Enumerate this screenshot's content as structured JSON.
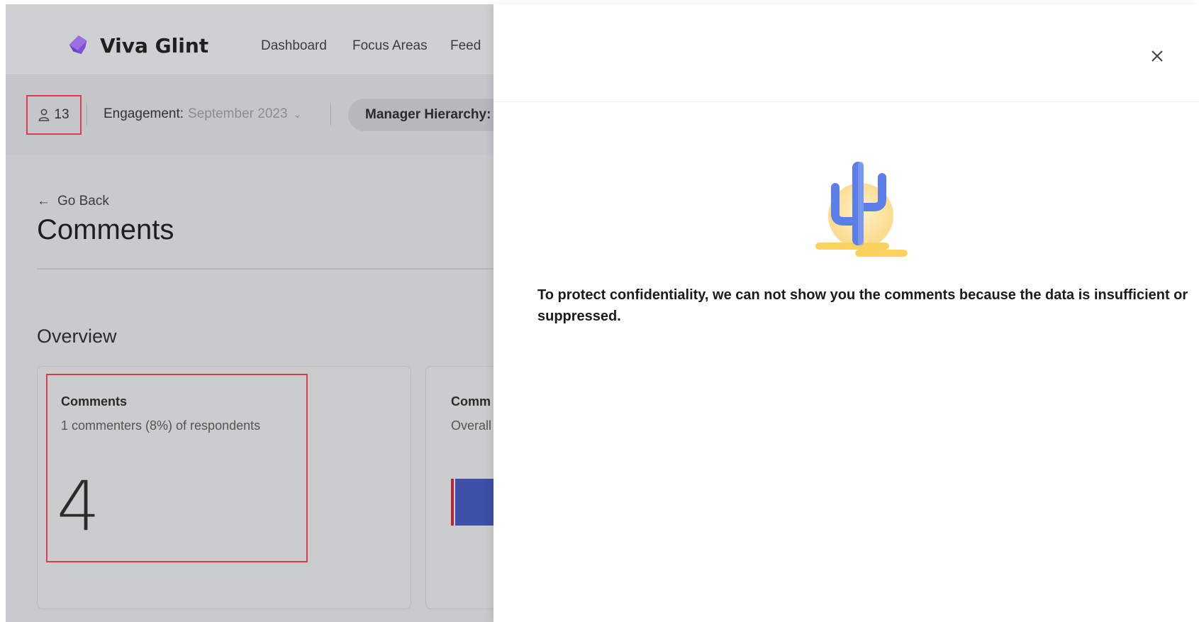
{
  "app": {
    "brand": "Viva Glint",
    "nav": [
      "Dashboard",
      "Focus Areas",
      "Feed"
    ],
    "respondent_count": "13",
    "filter": {
      "engagement_label": "Engagement:",
      "engagement_value": "September 2023",
      "manager_hierarchy_label": "Manager Hierarchy:"
    },
    "go_back": "Go Back",
    "page_title": "Comments",
    "overview_heading": "Overview",
    "card_comments": {
      "title": "Comments",
      "subtitle": "1 commenters (8%) of respondents",
      "value": "4"
    },
    "card_second": {
      "title": "Comm",
      "subtitle": "Overall"
    }
  },
  "panel": {
    "message": "To protect confidentiality, we can not show you the comments because the data is insufficient or suppressed."
  },
  "colors": {
    "highlight": "#e13b54",
    "brand_purple": "#7b4fd6",
    "cactus_blue": "#5b7fe6",
    "sun_yellow": "#fde6a6"
  },
  "icons": {
    "user": "person-icon",
    "close": "close-icon",
    "back": "arrow-left-icon",
    "dropdown": "chevron-down-icon",
    "illustration": "cactus-illustration"
  }
}
